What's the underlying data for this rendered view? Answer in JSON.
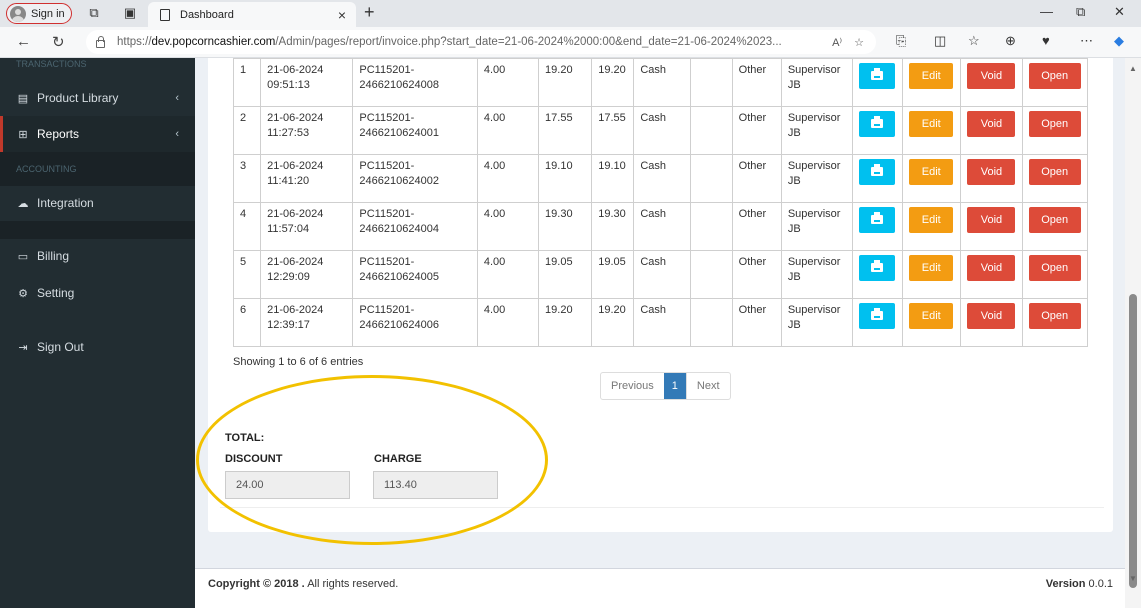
{
  "browser": {
    "sign_in": "Sign in",
    "tab_title": "Dashboard",
    "url_prefix": "https://",
    "url_host": "dev.popcorncashier.com",
    "url_rest": "/Admin/pages/report/invoice.php?start_date=21-06-2024%2000:00&end_date=21-06-2024%2023...",
    "read_aloud": "A⁾",
    "new_tab": "+",
    "close_tab": "×"
  },
  "sidebar": {
    "top_header": "TRANSACTIONS",
    "items": [
      {
        "label": "Product Library",
        "icon": "book-icon",
        "chevron": "‹"
      },
      {
        "label": "Reports",
        "icon": "table-icon",
        "chevron": "‹"
      },
      {
        "label": "Integration",
        "icon": "cloud-icon"
      },
      {
        "label": "Billing",
        "icon": "credit-card-icon"
      },
      {
        "label": "Setting",
        "icon": "gear-icon"
      },
      {
        "label": "Sign Out",
        "icon": "sign-out-icon"
      }
    ],
    "accounting_header": "ACCOUNTING"
  },
  "table": {
    "rows": [
      {
        "no": "1",
        "date": "21-06-2024",
        "time": "09:51:13",
        "inv1": "PC115201-",
        "inv2": "2466210624008",
        "disc": "4.00",
        "total": "19.20",
        "paid": "19.20",
        "method": "Cash",
        "extra": "",
        "type": "Other",
        "user1": "Supervisor",
        "user2": "JB"
      },
      {
        "no": "2",
        "date": "21-06-2024",
        "time": "11:27:53",
        "inv1": "PC115201-",
        "inv2": "2466210624001",
        "disc": "4.00",
        "total": "17.55",
        "paid": "17.55",
        "method": "Cash",
        "extra": "",
        "type": "Other",
        "user1": "Supervisor",
        "user2": "JB"
      },
      {
        "no": "3",
        "date": "21-06-2024",
        "time": "11:41:20",
        "inv1": "PC115201-",
        "inv2": "2466210624002",
        "disc": "4.00",
        "total": "19.10",
        "paid": "19.10",
        "method": "Cash",
        "extra": "",
        "type": "Other",
        "user1": "Supervisor",
        "user2": "JB"
      },
      {
        "no": "4",
        "date": "21-06-2024",
        "time": "11:57:04",
        "inv1": "PC115201-",
        "inv2": "2466210624004",
        "disc": "4.00",
        "total": "19.30",
        "paid": "19.30",
        "method": "Cash",
        "extra": "",
        "type": "Other",
        "user1": "Supervisor",
        "user2": "JB"
      },
      {
        "no": "5",
        "date": "21-06-2024",
        "time": "12:29:09",
        "inv1": "PC115201-",
        "inv2": "2466210624005",
        "disc": "4.00",
        "total": "19.05",
        "paid": "19.05",
        "method": "Cash",
        "extra": "",
        "type": "Other",
        "user1": "Supervisor",
        "user2": "JB"
      },
      {
        "no": "6",
        "date": "21-06-2024",
        "time": "12:39:17",
        "inv1": "PC115201-",
        "inv2": "2466210624006",
        "disc": "4.00",
        "total": "19.20",
        "paid": "19.20",
        "method": "Cash",
        "extra": "",
        "type": "Other",
        "user1": "Supervisor",
        "user2": "JB"
      }
    ],
    "buttons": {
      "edit": "Edit",
      "void": "Void",
      "open": "Open"
    }
  },
  "pagination": {
    "showing": "Showing 1 to 6 of 6 entries",
    "previous": "Previous",
    "current": "1",
    "next": "Next"
  },
  "totals": {
    "title": "TOTAL:",
    "discount_label": "DISCOUNT",
    "discount_value": "24.00",
    "charge_label": "CHARGE",
    "charge_value": "113.40"
  },
  "footer": {
    "copyright_bold": "Copyright © 2018 .",
    "copyright_rest": " All rights reserved.",
    "version_label": "Version",
    "version_value": " 0.0.1"
  },
  "colors": {
    "sidebar_bg": "#222d32",
    "print_btn": "#00c0ef",
    "edit_btn": "#f39c12",
    "danger_btn": "#dd4b39",
    "pager_active": "#337ab7",
    "highlight": "#f2c100"
  }
}
